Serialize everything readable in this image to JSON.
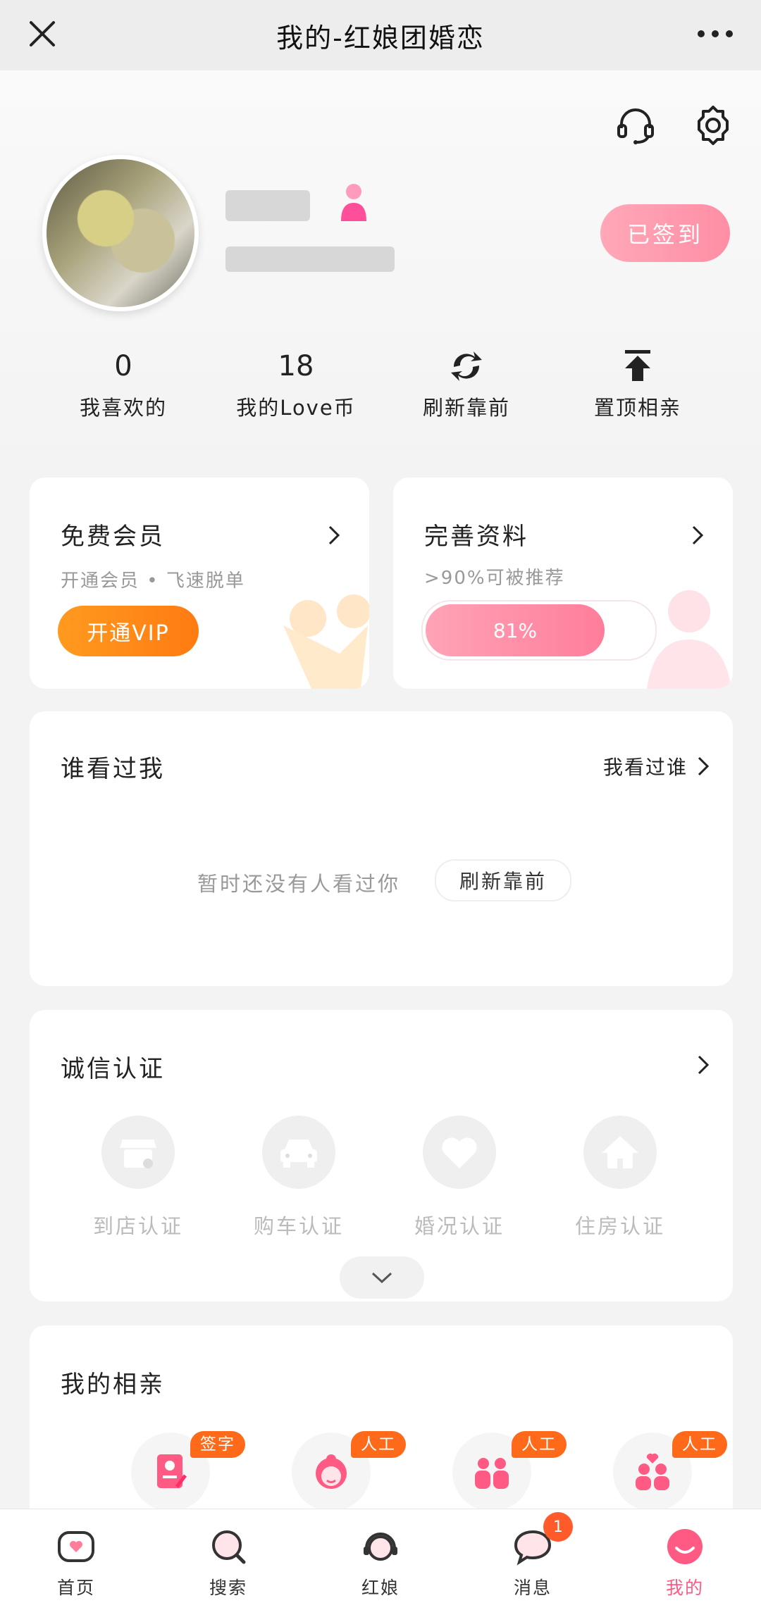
{
  "window": {
    "title": "我的-红娘团婚恋"
  },
  "profile": {
    "sign_button": "已签到"
  },
  "stats": [
    {
      "value": "0",
      "label": "我喜欢的"
    },
    {
      "value": "18",
      "label": "我的Love币"
    },
    {
      "icon": "refresh-icon",
      "label": "刷新靠前"
    },
    {
      "icon": "pin-top-icon",
      "label": "置顶相亲"
    }
  ],
  "vip_card": {
    "title": "免费会员",
    "subtitle": "开通会员 • 飞速脱单",
    "button": "开通VIP"
  },
  "profile_card": {
    "title": "完善资料",
    "subtitle": ">90%可被推荐",
    "progress_text": "81%",
    "progress": 0.81
  },
  "visitors": {
    "title": "谁看过我",
    "link": "我看过谁",
    "empty_text": "暂时还没有人看过你",
    "refresh_button": "刷新靠前"
  },
  "certification": {
    "title": "诚信认证",
    "items": [
      {
        "label": "到店认证",
        "icon": "store-icon"
      },
      {
        "label": "购车认证",
        "icon": "car-icon"
      },
      {
        "label": "婚况认证",
        "icon": "heart-icon"
      },
      {
        "label": "住房认证",
        "icon": "house-icon"
      }
    ]
  },
  "my_dating": {
    "title": "我的相亲",
    "items": [
      {
        "badge": "签字",
        "icon": "contract-icon"
      },
      {
        "badge": "人工",
        "icon": "matchmaker-icon"
      },
      {
        "badge": "人工",
        "icon": "couple-icon"
      },
      {
        "badge": "人工",
        "icon": "love-couple-icon"
      }
    ]
  },
  "tabbar": {
    "items": [
      {
        "label": "首页",
        "icon": "home-icon"
      },
      {
        "label": "搜索",
        "icon": "search-icon"
      },
      {
        "label": "红娘",
        "icon": "headset-icon"
      },
      {
        "label": "消息",
        "icon": "message-icon",
        "badge": "1"
      },
      {
        "label": "我的",
        "icon": "me-icon",
        "active": true
      }
    ]
  },
  "colors": {
    "accent_pink": "#ff7d9a",
    "vip_orange": "#ff8a18",
    "badge_orange": "#ff6a1a"
  }
}
